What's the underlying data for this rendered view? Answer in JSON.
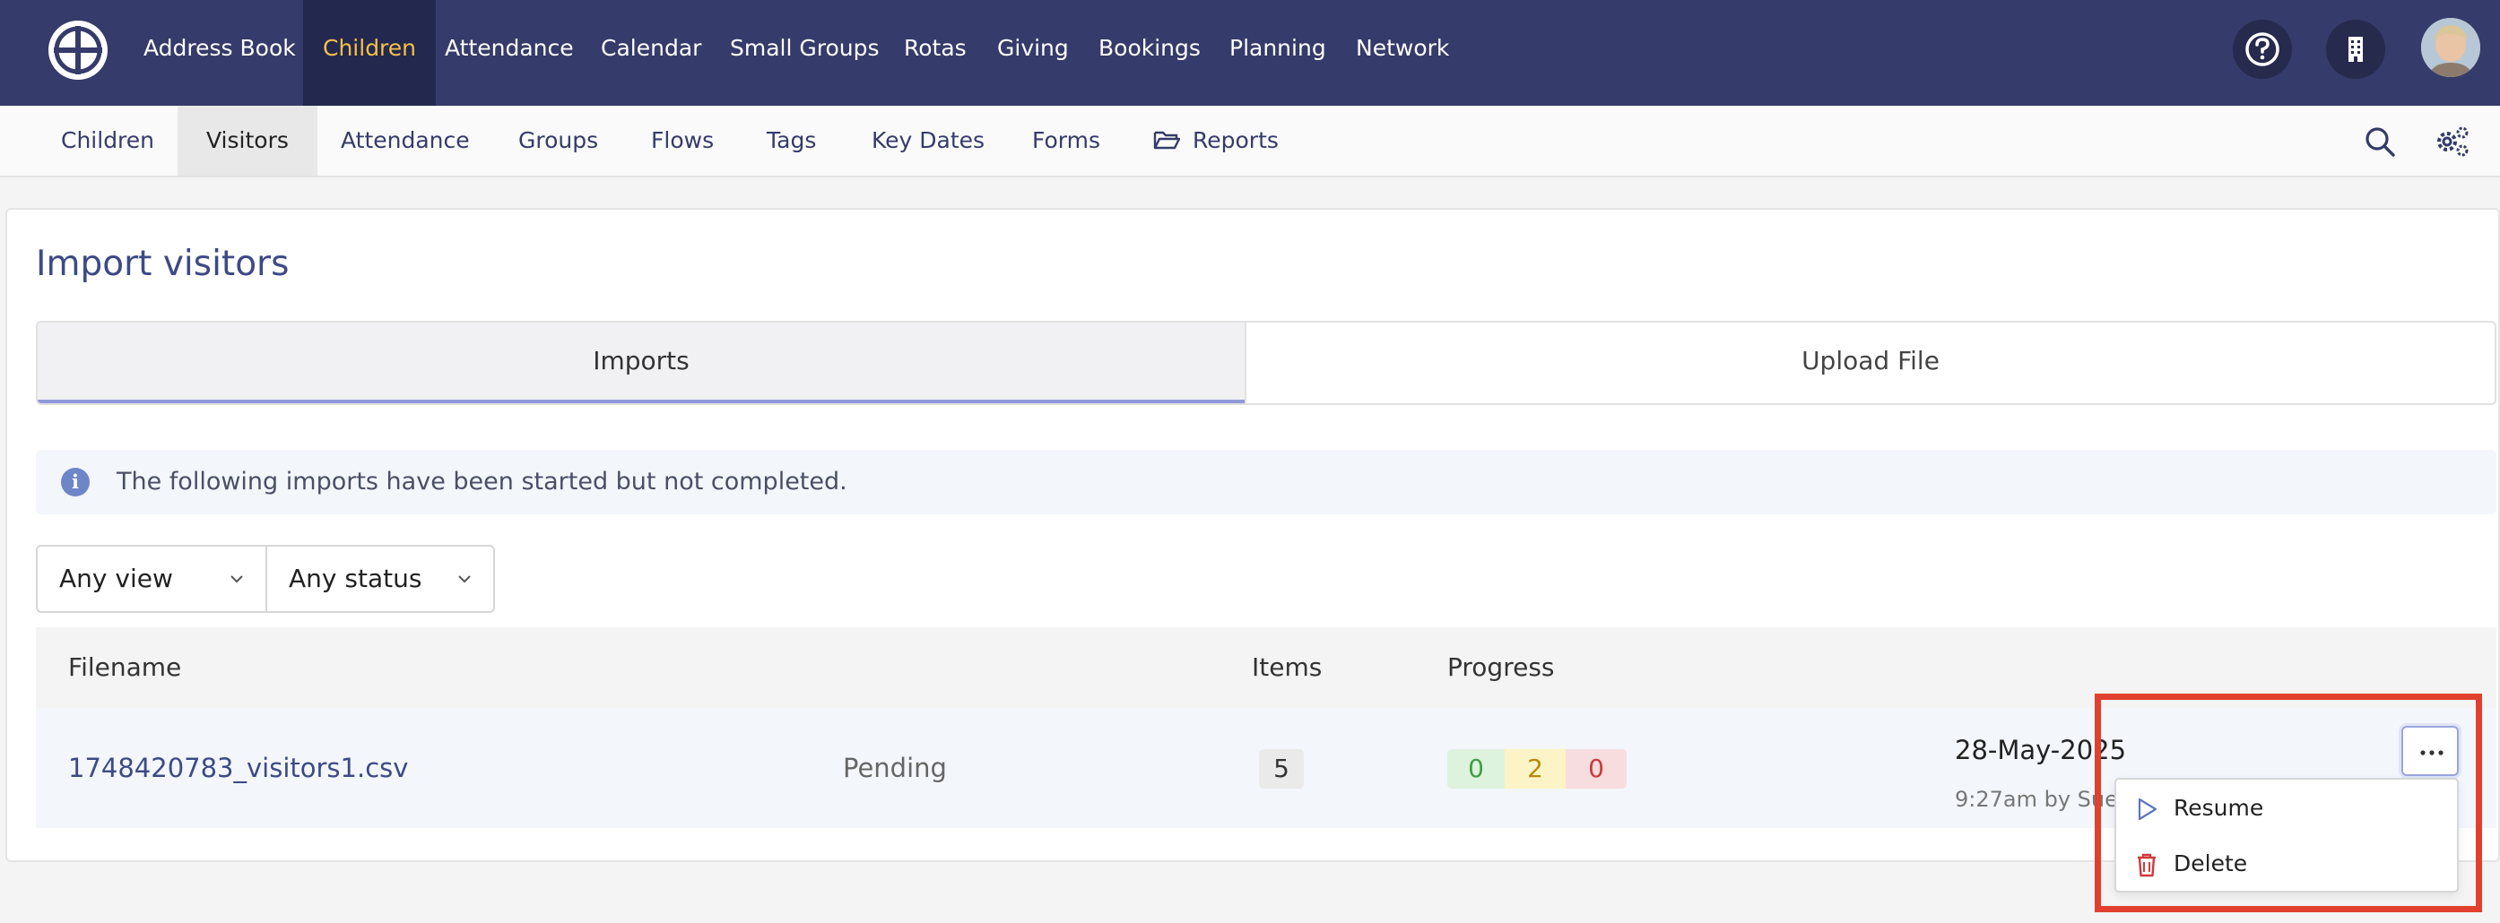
{
  "topnav": {
    "items": [
      {
        "label": "Address Book"
      },
      {
        "label": "Children",
        "active": true
      },
      {
        "label": "Attendance"
      },
      {
        "label": "Calendar"
      },
      {
        "label": "Small Groups"
      },
      {
        "label": "Rotas"
      },
      {
        "label": "Giving"
      },
      {
        "label": "Bookings"
      },
      {
        "label": "Planning"
      },
      {
        "label": "Network"
      }
    ],
    "active_color": "#f4c048",
    "bg_color": "#353b6a"
  },
  "subnav": {
    "items": [
      {
        "label": "Children"
      },
      {
        "label": "Visitors",
        "active": true
      },
      {
        "label": "Attendance"
      },
      {
        "label": "Groups"
      },
      {
        "label": "Flows"
      },
      {
        "label": "Tags"
      },
      {
        "label": "Key Dates"
      },
      {
        "label": "Forms"
      },
      {
        "label": "Reports"
      }
    ]
  },
  "page": {
    "title": "Import visitors",
    "tabs": [
      {
        "label": "Imports",
        "active": true
      },
      {
        "label": "Upload File"
      }
    ],
    "info": "The following imports have been started but not completed.",
    "filters": {
      "view": "Any view",
      "status": "Any status"
    }
  },
  "table": {
    "headers": {
      "filename": "Filename",
      "items": "Items",
      "progress": "Progress"
    },
    "rows": [
      {
        "filename": "1748420783_visitors1.csv",
        "status": "Pending",
        "items": "5",
        "progress": {
          "done": "0",
          "pending": "2",
          "failed": "0"
        },
        "date": "28-May-2025",
        "meta": "9:27am by Sue"
      }
    ]
  },
  "row_menu": {
    "items": [
      {
        "label": "Resume"
      },
      {
        "label": "Delete"
      }
    ]
  }
}
